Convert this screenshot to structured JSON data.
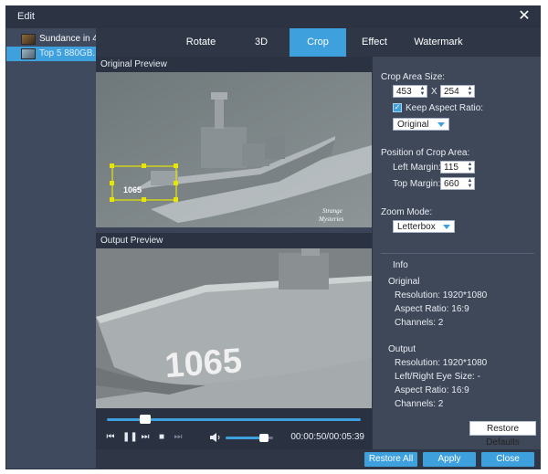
{
  "window": {
    "title": "Edit"
  },
  "files": [
    {
      "label": "Sundance in 4...",
      "selected": false
    },
    {
      "label": "Top 5 880GB...",
      "selected": true
    }
  ],
  "tabs": [
    {
      "label": "Rotate",
      "active": false
    },
    {
      "label": "3D",
      "active": false
    },
    {
      "label": "Crop",
      "active": true
    },
    {
      "label": "Effect",
      "active": false
    },
    {
      "label": "Watermark",
      "active": false
    }
  ],
  "original_preview": {
    "label": "Original Preview",
    "watermark_line1": "Strange",
    "watermark_line2": "Mysteries",
    "hull_number": "1065"
  },
  "output_preview": {
    "label": "Output Preview",
    "hull_number": "1065"
  },
  "player": {
    "time": "00:00:50/00:05:39",
    "progress": 0.15,
    "volume": 0.8
  },
  "crop": {
    "area_size_label": "Crop Area Size:",
    "width": "453",
    "separator": "X",
    "height": "254",
    "keep_aspect_label": "Keep Aspect Ratio:",
    "keep_aspect_checked": true,
    "aspect_value": "Original",
    "position_label": "Position of Crop Area:",
    "left_margin_label": "Left Margin:",
    "left_margin": "115",
    "top_margin_label": "Top Margin:",
    "top_margin": "660",
    "zoom_label": "Zoom Mode:",
    "zoom_value": "Letterbox"
  },
  "info": {
    "title": "Info",
    "original_title": "Original",
    "orig_resolution": "Resolution: 1920*1080",
    "orig_aspect": "Aspect Ratio: 16:9",
    "orig_channels": "Channels: 2",
    "output_title": "Output",
    "out_resolution": "Resolution: 1920*1080",
    "out_eye_size": "Left/Right Eye Size: -",
    "out_aspect": "Aspect Ratio: 16:9",
    "out_channels": "Channels: 2"
  },
  "buttons": {
    "restore_defaults": "Restore Defaults",
    "restore_all": "Restore All",
    "apply": "Apply",
    "close": "Close"
  },
  "colors": {
    "accent": "#3ea0dd",
    "panel": "#3b4457",
    "bar": "#2f3747"
  }
}
